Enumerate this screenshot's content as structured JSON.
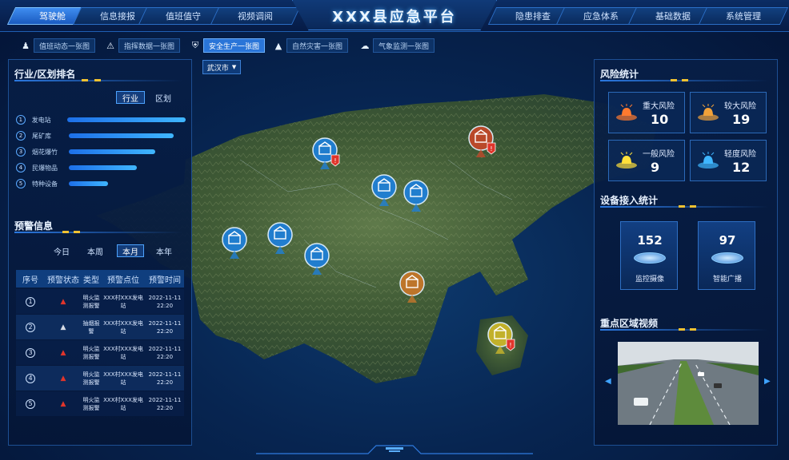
{
  "title": "XXX县应急平台",
  "nav_left": [
    "驾驶舱",
    "信息接报",
    "值班值守",
    "视频调阅"
  ],
  "nav_right": [
    "隐患排查",
    "应急体系",
    "基础数据",
    "系统管理"
  ],
  "subtabs": [
    "值班动态一张图",
    "指挥数据一张图",
    "安全生产一张图",
    "自然灾害一张图",
    "气象监测一张图"
  ],
  "city_select": "武汉市",
  "left_top": {
    "title": "行业/区划排名",
    "toggle": [
      "行业",
      "区划"
    ],
    "ranks": [
      {
        "n": "1",
        "label": "发电站",
        "value": 100
      },
      {
        "n": "2",
        "label": "尾矿库",
        "value": 85
      },
      {
        "n": "3",
        "label": "烟花爆竹",
        "value": 70
      },
      {
        "n": "4",
        "label": "民爆物品",
        "value": 55
      },
      {
        "n": "5",
        "label": "特种设备",
        "value": 32
      }
    ]
  },
  "left_bottom": {
    "title": "预警信息",
    "filters": [
      "今日",
      "本周",
      "本月",
      "本年"
    ],
    "headers": [
      "序号",
      "预警状态",
      "类型",
      "预警点位",
      "预警时间"
    ],
    "rows": [
      {
        "no": "1",
        "type": "明火监测报警",
        "site": "XXX村XXX发电站",
        "time": "2022-11-11 22:20",
        "level": "red"
      },
      {
        "no": "2",
        "type": "抽烟报警",
        "site": "XXX村XXX发电站",
        "time": "2022-11-11 22:20",
        "level": "white"
      },
      {
        "no": "3",
        "type": "明火监测报警",
        "site": "XXX村XXX发电站",
        "time": "2022-11-11 22:20",
        "level": "red"
      },
      {
        "no": "4",
        "type": "明火监测报警",
        "site": "XXX村XXX发电站",
        "time": "2022-11-11 22:20",
        "level": "red"
      },
      {
        "no": "5",
        "type": "明火监测报警",
        "site": "XXX村XXX发电站",
        "time": "2022-11-11 22:20",
        "level": "red"
      }
    ]
  },
  "right": {
    "risk_title": "风险统计",
    "risks": [
      {
        "label": "重大风险",
        "value": "10",
        "color": "#ff7a2f"
      },
      {
        "label": "较大风险",
        "value": "19",
        "color": "#f0a13a"
      },
      {
        "label": "一般风险",
        "value": "9",
        "color": "#ffe03a"
      },
      {
        "label": "轻度风险",
        "value": "12",
        "color": "#3fb6ff"
      }
    ],
    "device_title": "设备接入统计",
    "devices": [
      {
        "label": "监控摄像",
        "value": "152"
      },
      {
        "label": "智能广播",
        "value": "97"
      }
    ],
    "video_title": "重点区域视频"
  },
  "colors": {
    "accent": "#2a75d8",
    "panel": "#0a2858",
    "gold": "#f1c232",
    "danger": "#e0352b"
  }
}
